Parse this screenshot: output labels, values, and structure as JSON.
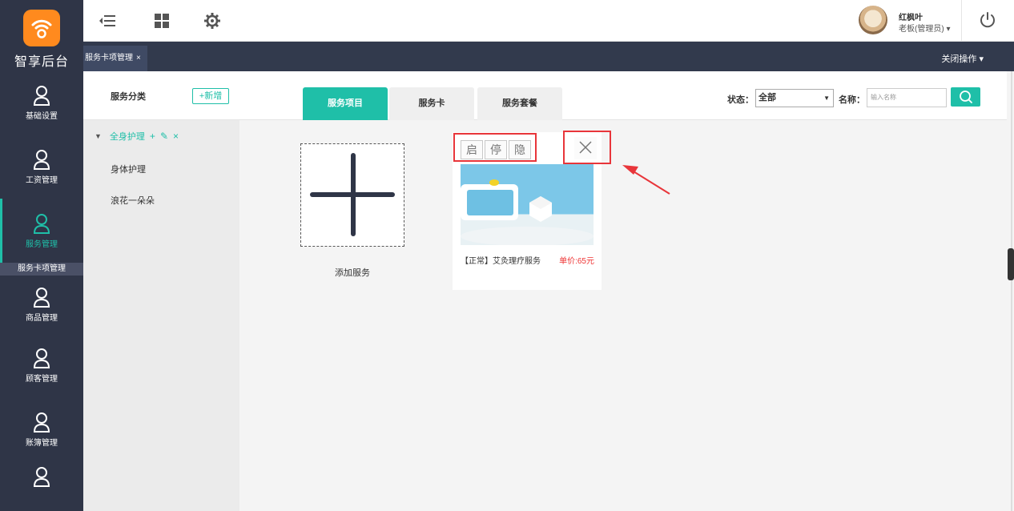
{
  "brand": {
    "name": "智享后台"
  },
  "sidebar": {
    "items": [
      {
        "label": "基础设置",
        "icon": "user-icon",
        "active": false
      },
      {
        "label": "工资管理",
        "icon": "user-icon",
        "active": false
      },
      {
        "label": "服务管理",
        "icon": "user-icon",
        "active": true
      },
      {
        "label": "商品管理",
        "icon": "user-icon",
        "active": false
      },
      {
        "label": "顾客管理",
        "icon": "user-icon",
        "active": false
      },
      {
        "label": "账簿管理",
        "icon": "user-icon",
        "active": false
      },
      {
        "label": "",
        "icon": "user-icon",
        "active": false
      }
    ],
    "active_sub": "服务卡项管理"
  },
  "topbar": {
    "user_name": "红枫叶",
    "user_role": "老板(管理员) ▾",
    "icons": [
      "menu-collapse-icon",
      "grid-icon",
      "gear-icon",
      "power-icon"
    ]
  },
  "tabstrip": {
    "open_tab": "服务卡项管理",
    "open_tab_close": "×",
    "close_ops": "关闭操作 ▾"
  },
  "category": {
    "title": "服务分类",
    "add_label": "+新增",
    "root": {
      "label": "全身护理",
      "ops": [
        "+",
        "✎",
        "×"
      ]
    },
    "children": [
      "身体护理",
      "浪花一朵朵"
    ]
  },
  "main": {
    "tabs": [
      {
        "label": "服务项目",
        "active": true
      },
      {
        "label": "服务卡",
        "active": false
      },
      {
        "label": "服务套餐",
        "active": false
      }
    ],
    "filter": {
      "status_label": "状态：",
      "status_value": "全部",
      "name_label": "名称：",
      "name_placeholder": "输入名称"
    },
    "add_service_label": "添加服务",
    "service_card": {
      "actions": [
        "启",
        "停",
        "隐"
      ],
      "title": "【正常】艾灸理疗服务",
      "price": "单价:65元"
    }
  },
  "colors": {
    "accent": "#1fbfa8",
    "sidebar": "#2f3547",
    "logo": "#ff8a1e",
    "highlight": "#e8353a",
    "price": "#ee3333"
  }
}
